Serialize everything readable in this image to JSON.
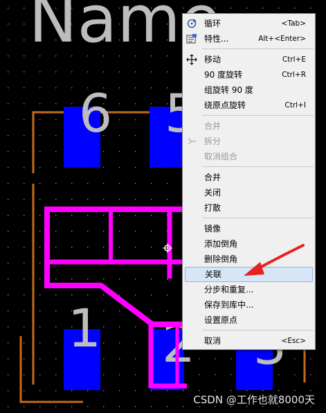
{
  "canvas": {
    "name_text": "Name",
    "pin_numbers": [
      "6",
      "5",
      "1",
      "2",
      "3"
    ],
    "colors": {
      "background": "#000000",
      "pad": "#0000ff",
      "silk": "#bdbdbd",
      "outline": "#c46a1c",
      "selection": "#ff00ff"
    }
  },
  "menu": {
    "items": [
      {
        "label": "循环",
        "shortcut": "<Tab>",
        "icon": "cycle-icon",
        "enabled": true
      },
      {
        "label": "特性...",
        "shortcut": "Alt+<Enter>",
        "icon": "properties-icon",
        "enabled": true
      },
      {
        "label": "移动",
        "shortcut": "Ctrl+E",
        "icon": "move-icon",
        "enabled": true
      },
      {
        "label": "90 度旋转",
        "shortcut": "Ctrl+R",
        "enabled": true
      },
      {
        "label": "组旋转 90 度",
        "shortcut": "",
        "enabled": true
      },
      {
        "label": "绕原点旋转",
        "shortcut": "Ctrl+I",
        "enabled": true
      },
      {
        "label": "合并",
        "shortcut": "",
        "enabled": false
      },
      {
        "label": "拆分",
        "shortcut": "",
        "enabled": false
      },
      {
        "label": "取消组合",
        "shortcut": "",
        "enabled": false
      },
      {
        "label": "合并",
        "shortcut": "",
        "enabled": true
      },
      {
        "label": "关闭",
        "shortcut": "",
        "enabled": true
      },
      {
        "label": "打散",
        "shortcut": "",
        "enabled": true
      },
      {
        "label": "镜像",
        "shortcut": "",
        "enabled": true
      },
      {
        "label": "添加倒角",
        "shortcut": "",
        "enabled": true
      },
      {
        "label": "删除倒角",
        "shortcut": "",
        "enabled": true
      },
      {
        "label": "关联",
        "shortcut": "",
        "enabled": true,
        "highlighted": true
      },
      {
        "label": "分步和重复...",
        "shortcut": "",
        "enabled": true
      },
      {
        "label": "保存到库中...",
        "shortcut": "",
        "enabled": true
      },
      {
        "label": "设置原点",
        "shortcut": "",
        "enabled": true
      },
      {
        "label": "取消",
        "shortcut": "<Esc>",
        "enabled": true
      }
    ]
  },
  "annotation": {
    "arrow_color": "#e8201e"
  },
  "watermark": "CSDN @工作也就8000天"
}
